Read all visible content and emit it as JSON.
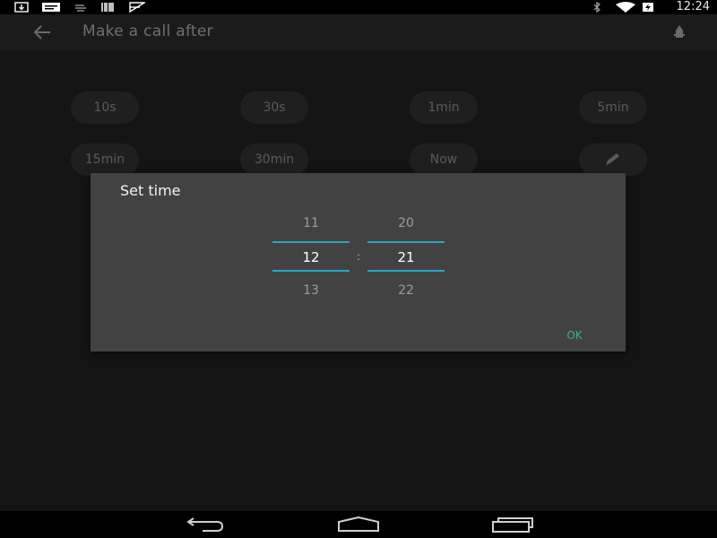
{
  "status_bar": {
    "time": "12:24",
    "icons": [
      "download-icon",
      "message-icon",
      "cast-icon",
      "barcode-icon",
      "mail-sent-icon",
      "bluetooth-icon",
      "wifi-icon",
      "battery-charging-icon"
    ]
  },
  "app_bar": {
    "title": "Make a call after",
    "back_icon": "arrow-left-icon",
    "action_icon": "rocket-icon"
  },
  "quick_options": {
    "row1": [
      "10s",
      "30s",
      "1min",
      "5min"
    ],
    "row2": [
      "15min",
      "30min",
      "Now"
    ],
    "edit_icon": "pencil-icon"
  },
  "dialog": {
    "title": "Set time",
    "hours": {
      "prev": "11",
      "current": "12",
      "next": "13"
    },
    "separator": ":",
    "minutes": {
      "prev": "20",
      "current": "21",
      "next": "22"
    },
    "ok_label": "OK"
  },
  "colors": {
    "accent_line": "#2aa4c7",
    "ok_text": "#2fb58f",
    "dialog_bg": "#424242"
  },
  "nav_bar": {
    "icons": [
      "back-nav-icon",
      "home-nav-icon",
      "recents-nav-icon"
    ]
  }
}
